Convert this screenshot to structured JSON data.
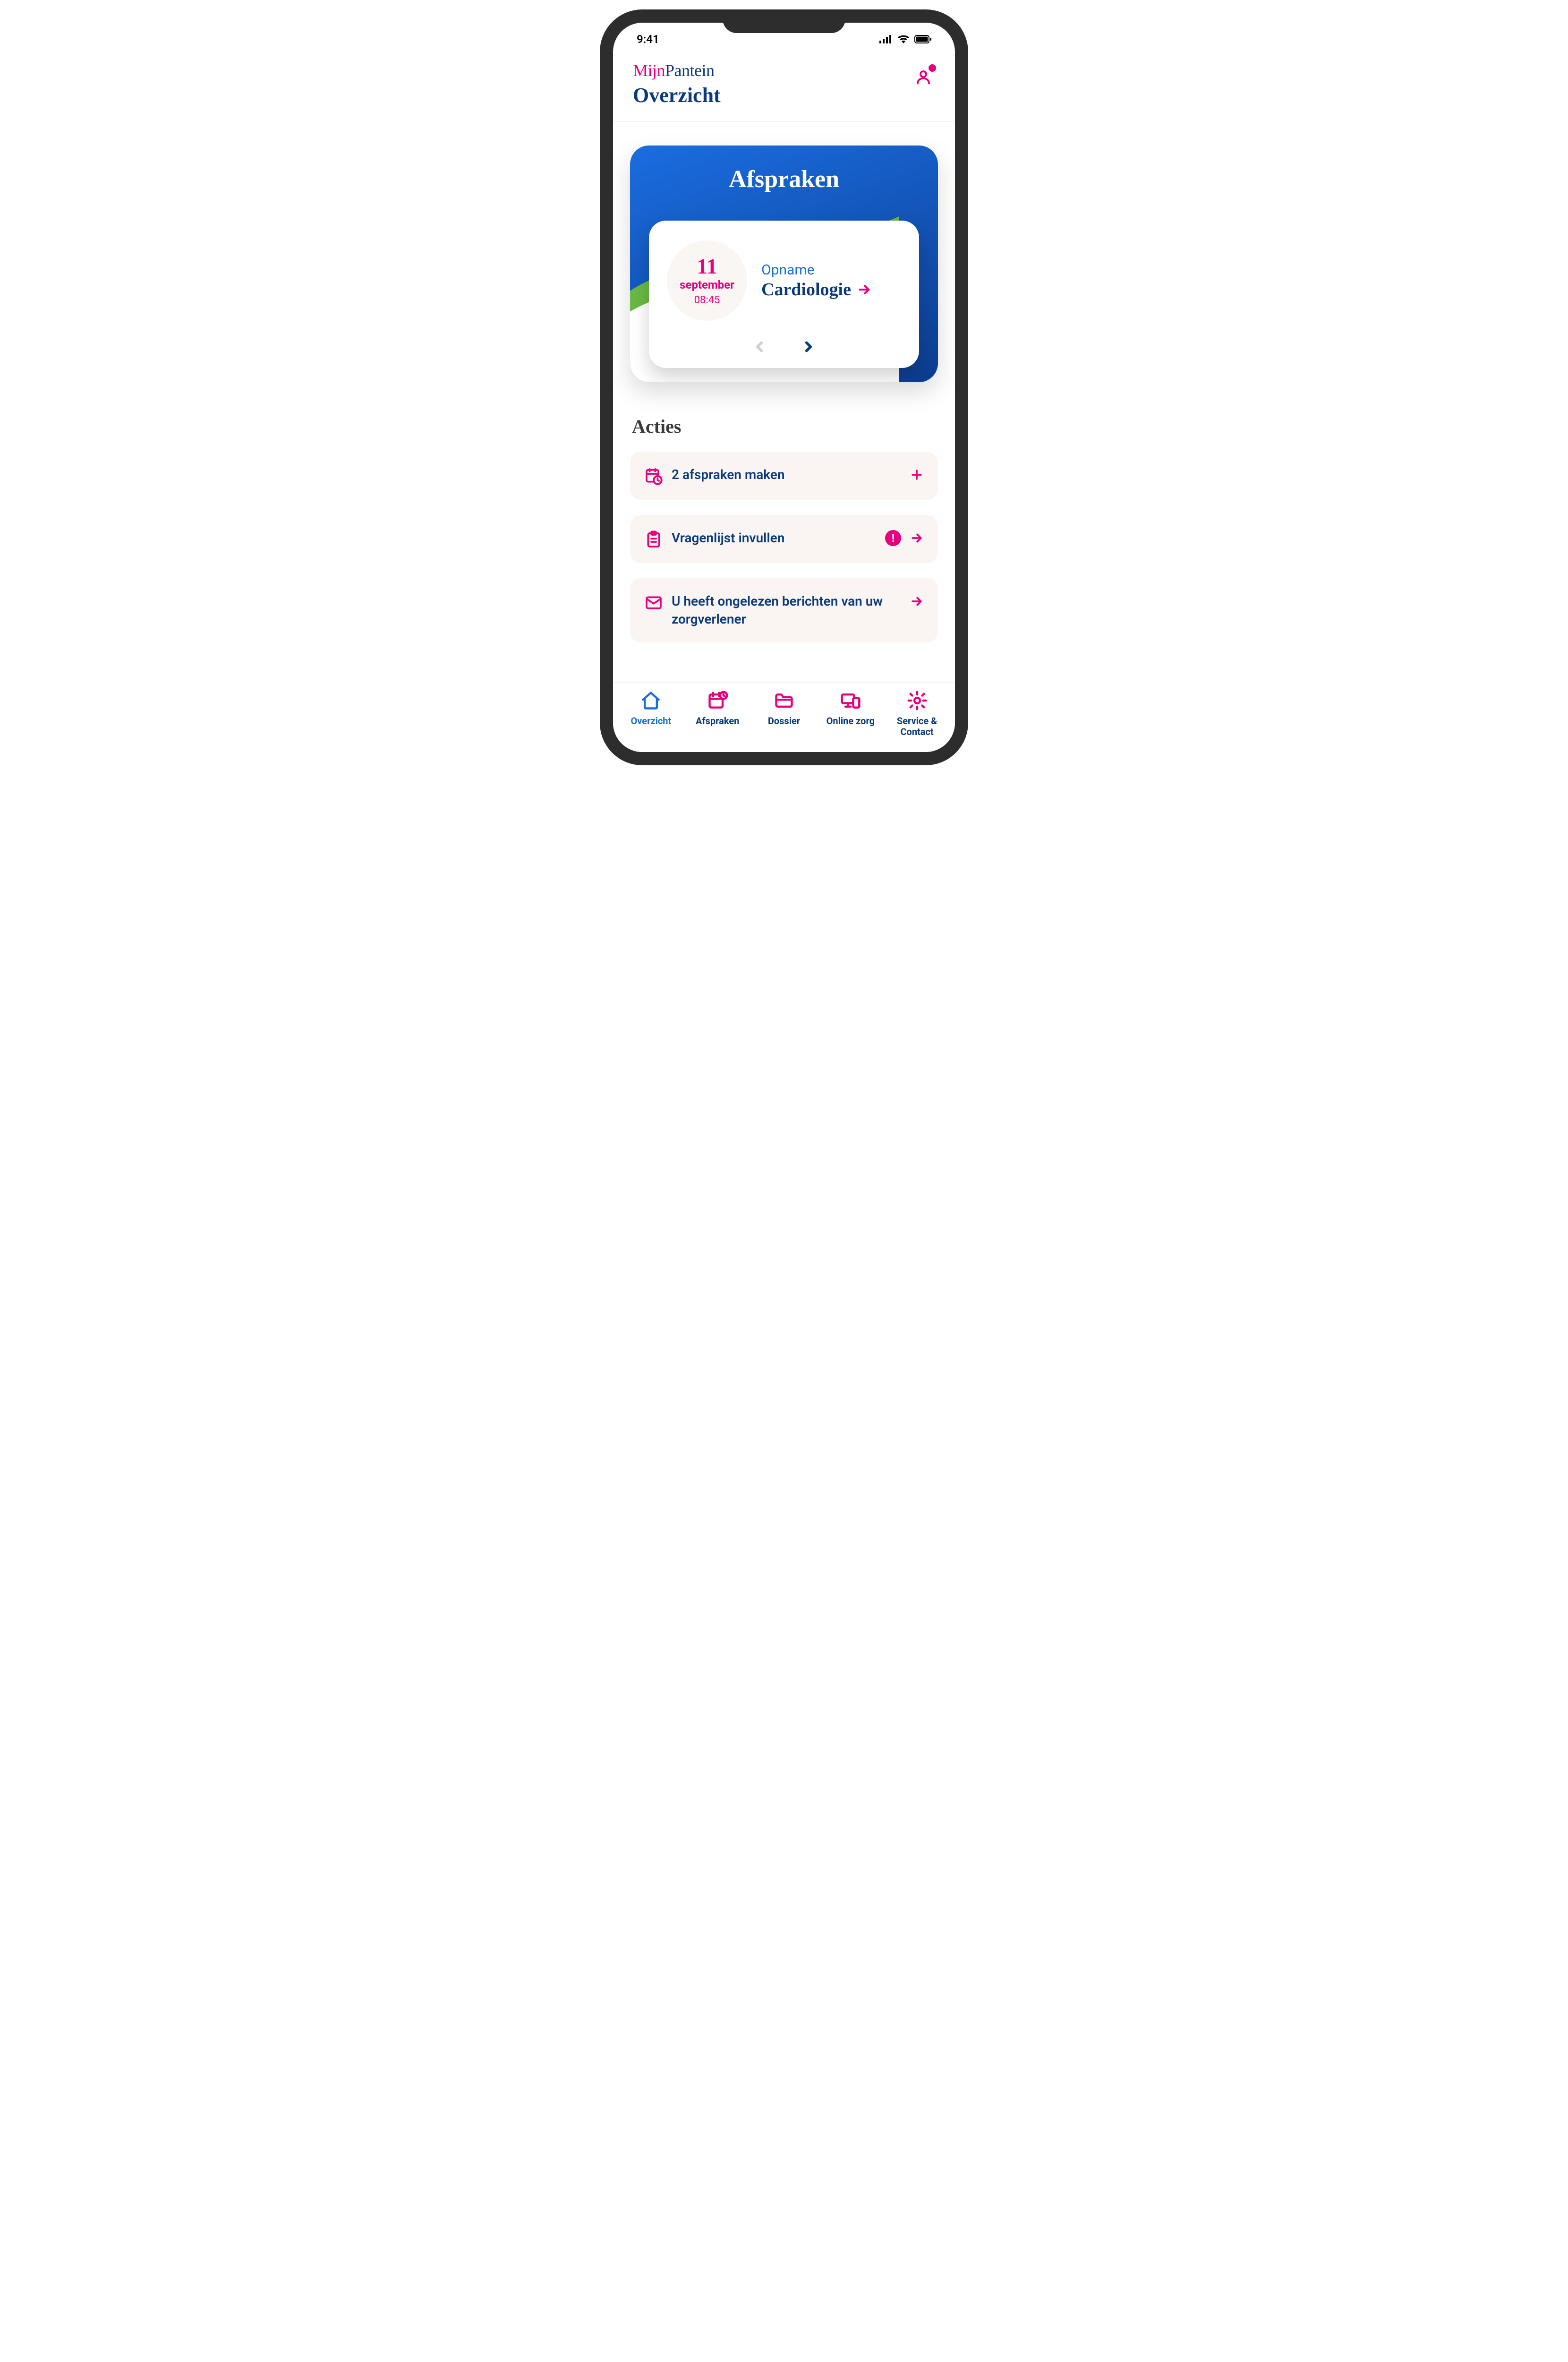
{
  "status": {
    "time": "9:41"
  },
  "header": {
    "logo_mijn": "Mijn",
    "logo_pantein": "Pantein",
    "page_title": "Overzicht"
  },
  "afspraken": {
    "title": "Afspraken",
    "appointment": {
      "day": "11",
      "month": "september",
      "time": "08:45",
      "type": "Opname",
      "department": "Cardiologie"
    }
  },
  "acties": {
    "title": "Acties",
    "items": [
      {
        "label": "2 afspraken maken",
        "has_alert": false,
        "right": "plus"
      },
      {
        "label": "Vragenlijst invullen",
        "has_alert": true,
        "right": "arrow"
      },
      {
        "label": "U heeft ongelezen berichten van uw zorgverlener",
        "has_alert": false,
        "right": "arrow"
      }
    ]
  },
  "tabs": [
    {
      "label": "Overzicht"
    },
    {
      "label": "Afspraken"
    },
    {
      "label": "Dossier"
    },
    {
      "label": "Online zorg"
    },
    {
      "label": "Service & Contact"
    }
  ]
}
